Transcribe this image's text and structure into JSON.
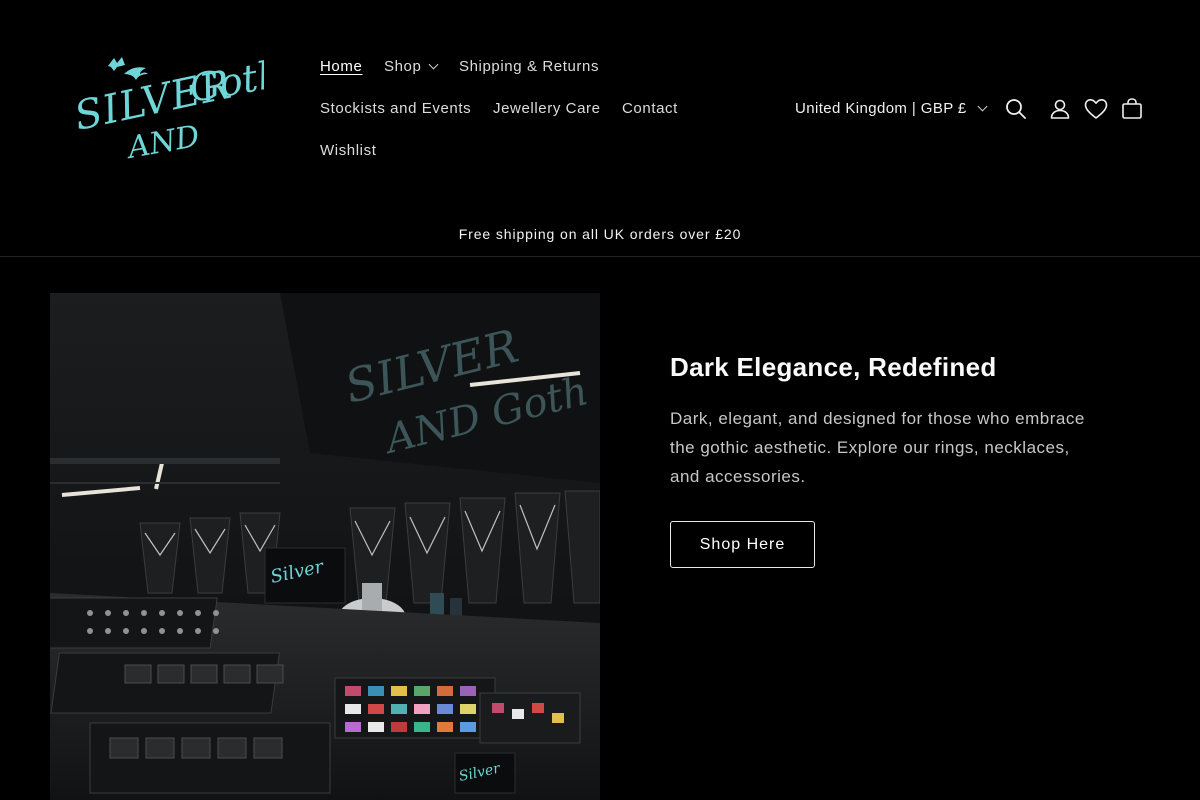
{
  "brand": {
    "logo_text_line1": "SILVER",
    "logo_text_line2": "AND GOTH",
    "accent": "#6fd6d8"
  },
  "nav": {
    "items": [
      {
        "label": "Home",
        "active": true
      },
      {
        "label": "Shop",
        "has_dropdown": true
      },
      {
        "label": "Shipping & Returns"
      },
      {
        "label": "Stockists and Events"
      },
      {
        "label": "Jewellery Care"
      },
      {
        "label": "Contact"
      },
      {
        "label": "Wishlist"
      }
    ]
  },
  "utility": {
    "region_label": "United Kingdom | GBP £",
    "icons": [
      "search-icon",
      "account-icon",
      "heart-icon",
      "cart-icon"
    ]
  },
  "announcement": {
    "text": "Free shipping on all UK orders over £20"
  },
  "hero": {
    "image_alt": "Market stall displaying gothic jewellery on black busts and trays",
    "heading": "Dark Elegance, Redefined",
    "body": "Dark, elegant, and designed for those who embrace the gothic aesthetic. Explore our rings, necklaces, and accessories.",
    "button_label": "Shop Here"
  },
  "colors": {
    "background": "#000000",
    "text": "#ffffff",
    "muted_text": "#c7c7c7",
    "divider": "#232323"
  }
}
